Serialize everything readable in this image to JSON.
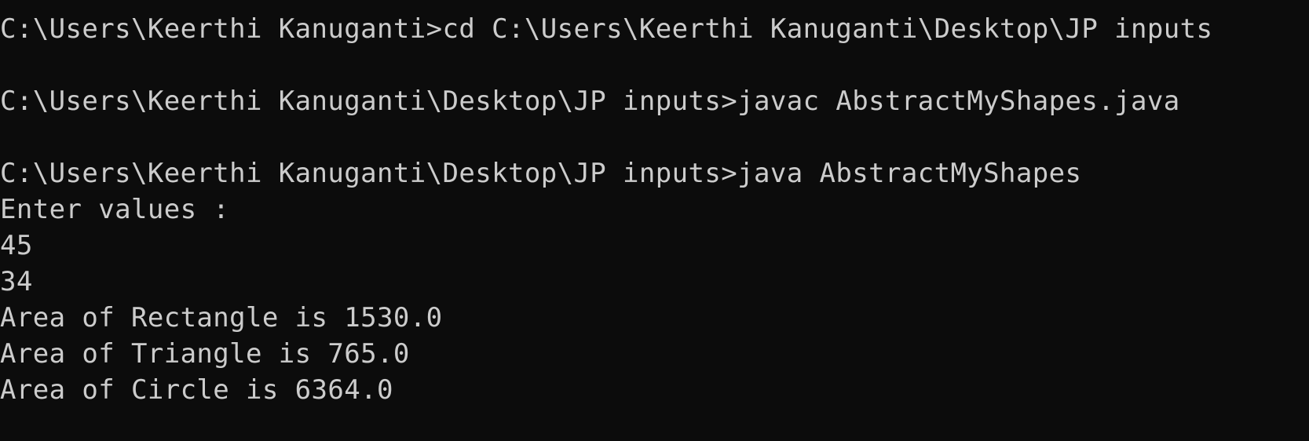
{
  "terminal": {
    "lines": [
      "C:\\Users\\Keerthi Kanuganti>cd C:\\Users\\Keerthi Kanuganti\\Desktop\\JP inputs",
      "",
      "C:\\Users\\Keerthi Kanuganti\\Desktop\\JP inputs>javac AbstractMyShapes.java",
      "",
      "C:\\Users\\Keerthi Kanuganti\\Desktop\\JP inputs>java AbstractMyShapes",
      "Enter values :",
      "45",
      "34",
      "Area of Rectangle is 1530.0",
      "Area of Triangle is 765.0",
      "Area of Circle is 6364.0"
    ]
  },
  "colors": {
    "background": "#0c0c0c",
    "foreground": "#cccccc"
  }
}
